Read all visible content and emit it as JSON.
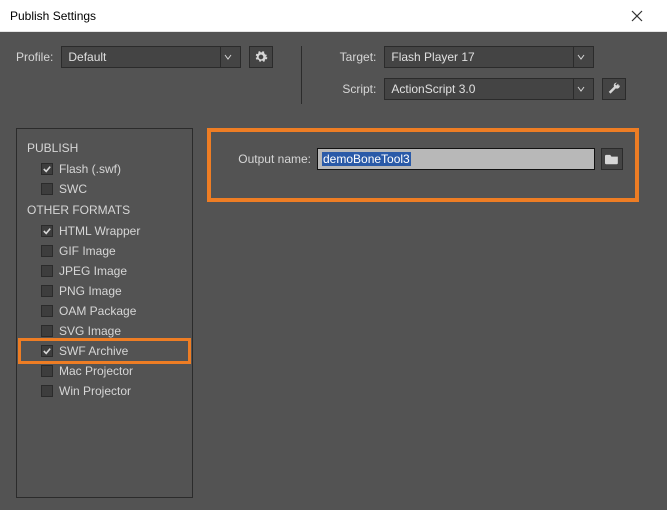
{
  "window": {
    "title": "Publish Settings"
  },
  "profile": {
    "label": "Profile:",
    "value": "Default"
  },
  "target": {
    "label": "Target:",
    "value": "Flash Player 17"
  },
  "script": {
    "label": "Script:",
    "value": "ActionScript 3.0"
  },
  "output": {
    "label": "Output name:",
    "value": "demoBoneTool3"
  },
  "sidebar": {
    "section_publish": "PUBLISH",
    "section_other": "OTHER FORMATS",
    "items": [
      {
        "label": "Flash (.swf)",
        "checked": true
      },
      {
        "label": "SWC",
        "checked": false
      },
      {
        "label": "HTML Wrapper",
        "checked": true
      },
      {
        "label": "GIF Image",
        "checked": false
      },
      {
        "label": "JPEG Image",
        "checked": false
      },
      {
        "label": "PNG Image",
        "checked": false
      },
      {
        "label": "OAM Package",
        "checked": false
      },
      {
        "label": "SVG Image",
        "checked": false
      },
      {
        "label": "SWF Archive",
        "checked": true
      },
      {
        "label": "Mac Projector",
        "checked": false
      },
      {
        "label": "Win Projector",
        "checked": false
      }
    ]
  }
}
